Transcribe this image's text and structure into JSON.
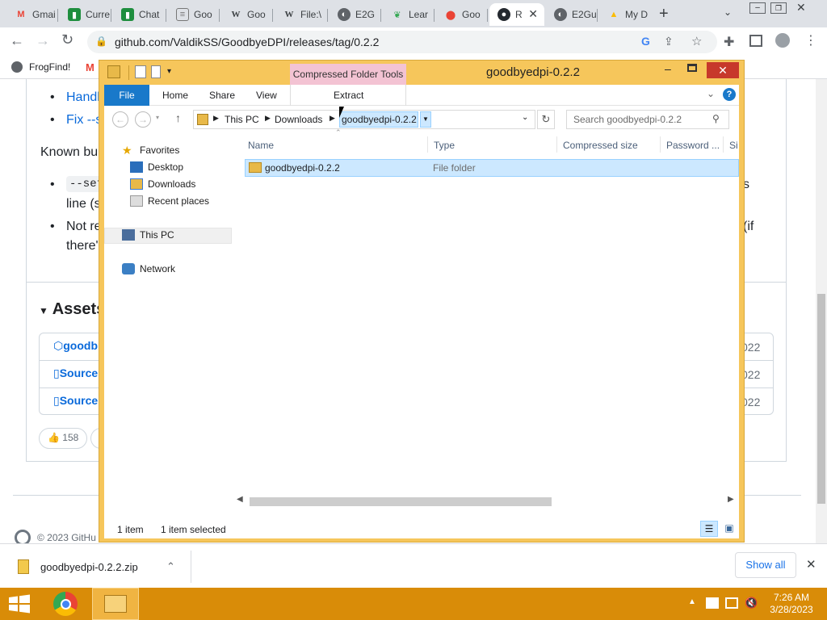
{
  "browser": {
    "tabs": [
      {
        "label": "Gmai",
        "icon": "gmail-icon"
      },
      {
        "label": "Curre",
        "icon": "chat-icon"
      },
      {
        "label": "Chat",
        "icon": "chat-icon"
      },
      {
        "label": "Goo",
        "icon": "doc-icon"
      },
      {
        "label": "Goo",
        "icon": "wikipedia-icon"
      },
      {
        "label": "File:\\",
        "icon": "wikipedia-icon"
      },
      {
        "label": "E2G",
        "icon": "globe-icon"
      },
      {
        "label": "Lear",
        "icon": "learn-icon"
      },
      {
        "label": "Goo",
        "icon": "maps-icon"
      },
      {
        "label": "R",
        "icon": "github-icon"
      },
      {
        "label": "E2Gu",
        "icon": "globe-icon"
      },
      {
        "label": "My D",
        "icon": "drive-icon"
      }
    ],
    "url": "github.com/ValdikSS/GoodbyeDPI/releases/tag/0.2.2",
    "bookmarks": [
      {
        "label": "FrogFind!"
      }
    ]
  },
  "page": {
    "bullets_top": [
      "Handl",
      "Fix --s"
    ],
    "known_bugs": "Known bu",
    "bug1_code": "--set",
    "bug1_rest": "line (s",
    "bug1_tail": "s",
    "bug2": "Not re",
    "bug2b": "there'",
    "bug2_tail": "(if",
    "assets_title": "Assets",
    "assets": [
      {
        "name": "goodb",
        "date": "022"
      },
      {
        "name": "Source",
        "date": "022"
      },
      {
        "name": "Source",
        "date": "022"
      }
    ],
    "reaction_count": "158",
    "footer": "© 2023 GitHu"
  },
  "explorer": {
    "title": "goodbyedpi-0.2.2",
    "context_tab": "Compressed Folder Tools",
    "ribbon_tabs": [
      "File",
      "Home",
      "Share",
      "View",
      "Extract"
    ],
    "breadcrumb": [
      "This PC",
      "Downloads",
      "goodbyedpi-0.2.2"
    ],
    "search_placeholder": "Search goodbyedpi-0.2.2",
    "nav": {
      "favorites": "Favorites",
      "desktop": "Desktop",
      "downloads": "Downloads",
      "recent": "Recent places",
      "thispc": "This PC",
      "network": "Network"
    },
    "columns": [
      "Name",
      "Type",
      "Compressed size",
      "Password ...",
      "Si"
    ],
    "rows": [
      {
        "name": "goodbyedpi-0.2.2",
        "type": "File folder"
      }
    ],
    "status_items": "1 item",
    "status_selected": "1 item selected"
  },
  "downloads_bar": {
    "file": "goodbyedpi-0.2.2.zip",
    "show_all": "Show all"
  },
  "taskbar": {
    "time": "7:26 AM",
    "date": "3/28/2023"
  },
  "colors": {
    "taskbar": "#d98c08",
    "explorer_frame": "#f6c65b",
    "accent": "#0969da",
    "selection": "#cce8ff"
  }
}
